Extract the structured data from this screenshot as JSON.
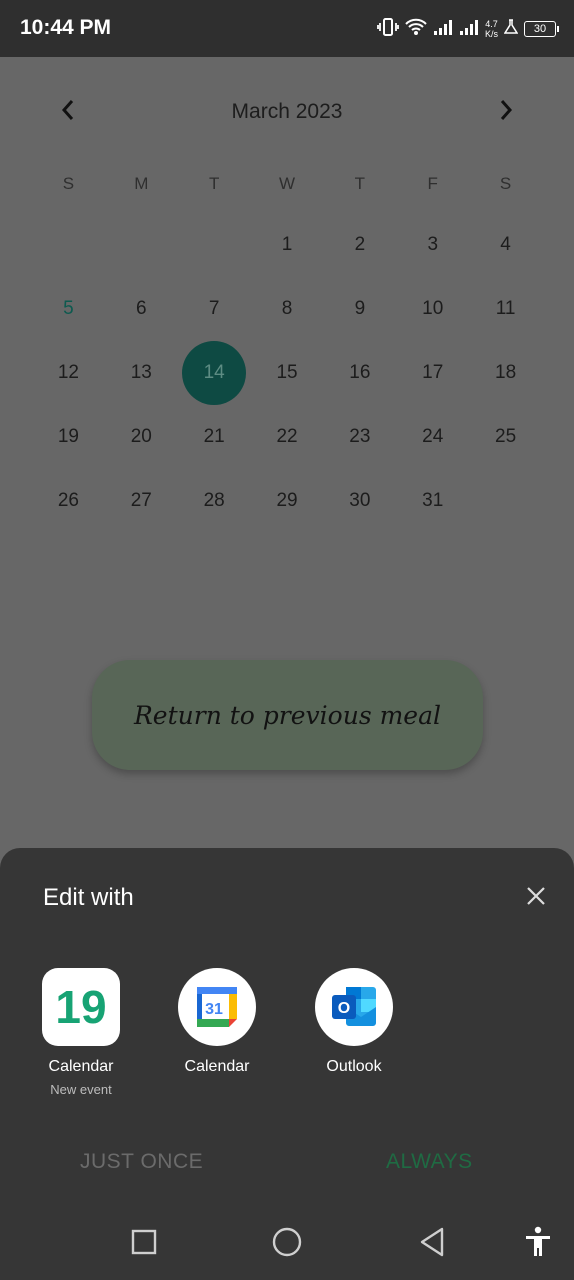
{
  "status": {
    "time": "10:44 PM",
    "speed_value": "4.7",
    "speed_unit": "K/s",
    "battery": "30",
    "icons": [
      "vibrate-icon",
      "wifi-icon",
      "signal-icon",
      "signal-icon",
      "lab-icon",
      "battery-icon"
    ]
  },
  "calendar": {
    "month_title": "March 2023",
    "days_of_week": [
      "S",
      "M",
      "T",
      "W",
      "T",
      "F",
      "S"
    ],
    "weeks": [
      [
        "",
        "",
        "",
        "1",
        "2",
        "3",
        "4"
      ],
      [
        "5",
        "6",
        "7",
        "8",
        "9",
        "10",
        "11"
      ],
      [
        "12",
        "13",
        "14",
        "15",
        "16",
        "17",
        "18"
      ],
      [
        "19",
        "20",
        "21",
        "22",
        "23",
        "24",
        "25"
      ],
      [
        "26",
        "27",
        "28",
        "29",
        "30",
        "31",
        ""
      ]
    ],
    "today": "5",
    "selected": "14",
    "accent_color": "#0e4a43"
  },
  "return_button": {
    "label": "Return to previous meal"
  },
  "sheet": {
    "title": "Edit with",
    "apps": [
      {
        "label": "Calendar",
        "sublabel": "New event",
        "icon": "calendar-19-icon",
        "icon_text": "19"
      },
      {
        "label": "Calendar",
        "sublabel": "",
        "icon": "google-calendar-icon",
        "icon_text": "31"
      },
      {
        "label": "Outlook",
        "sublabel": "",
        "icon": "outlook-icon",
        "icon_text": "O"
      }
    ],
    "just_once": "JUST ONCE",
    "always": "ALWAYS",
    "always_color": "#1f6b43"
  },
  "navbar": {
    "icons": [
      "recents-icon",
      "home-icon",
      "back-icon",
      "accessibility-icon"
    ]
  }
}
